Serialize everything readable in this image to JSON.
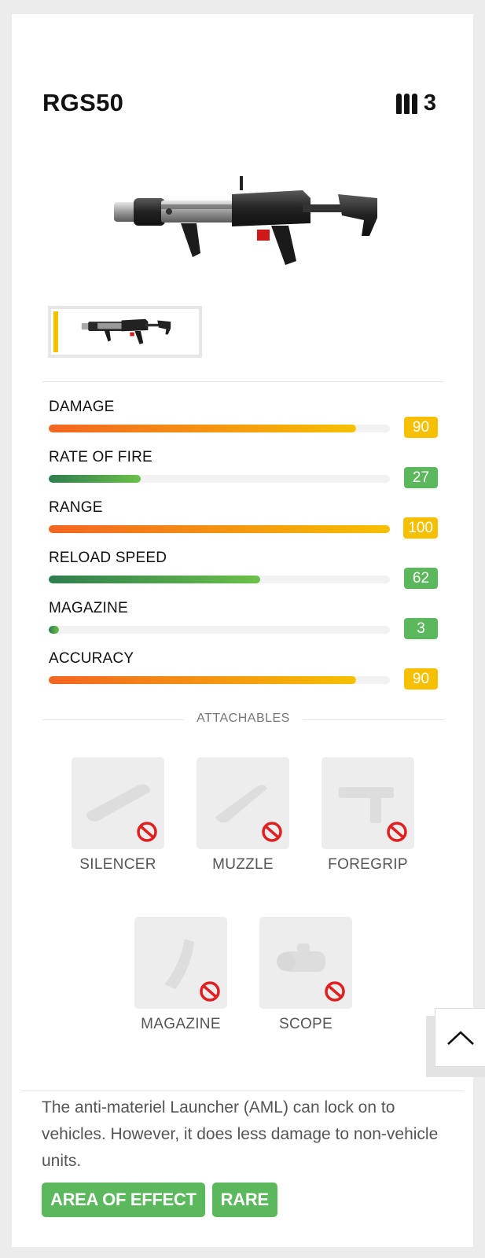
{
  "weapon": {
    "name": "RGS50",
    "ammo_count": "3",
    "ammo_icon": "bullets-icon"
  },
  "stats": [
    {
      "label": "DAMAGE",
      "value": "90",
      "fraction": 0.9,
      "gradient": "orange",
      "badge_color": "#f6c000"
    },
    {
      "label": "RATE OF FIRE",
      "value": "27",
      "fraction": 0.27,
      "gradient": "green",
      "badge_color": "#5cb85c"
    },
    {
      "label": "RANGE",
      "value": "100",
      "fraction": 1.0,
      "gradient": "orange",
      "badge_color": "#f6c000"
    },
    {
      "label": "RELOAD SPEED",
      "value": "62",
      "fraction": 0.62,
      "gradient": "green",
      "badge_color": "#5cb85c"
    },
    {
      "label": "MAGAZINE",
      "value": "3",
      "fraction": 0.03,
      "gradient": "green",
      "badge_color": "#5cb85c"
    },
    {
      "label": "ACCURACY",
      "value": "90",
      "fraction": 0.9,
      "gradient": "orange",
      "badge_color": "#f6c000"
    }
  ],
  "attachables": {
    "title": "ATTACHABLES",
    "items": [
      {
        "label": "SILENCER",
        "icon": "silencer-icon",
        "available": false
      },
      {
        "label": "MUZZLE",
        "icon": "muzzle-icon",
        "available": false
      },
      {
        "label": "FOREGRIP",
        "icon": "foregrip-icon",
        "available": false
      },
      {
        "label": "MAGAZINE",
        "icon": "magazine-icon",
        "available": false
      },
      {
        "label": "SCOPE",
        "icon": "scope-icon",
        "available": false
      }
    ]
  },
  "description": "The anti-materiel Launcher (AML) can lock on to vehicles. However, it does less damage to non-vehicle units.",
  "tags": [
    "AREA OF EFFECT",
    "RARE"
  ],
  "colors": {
    "orange_start": "#f26522",
    "orange_end": "#f6c000",
    "green_start": "#2e7d4f",
    "green_end": "#6cc04a",
    "tag_green": "#5cb85c",
    "thumb_accent": "#f2c200"
  },
  "scroll_button_icon": "chevron-up-icon"
}
